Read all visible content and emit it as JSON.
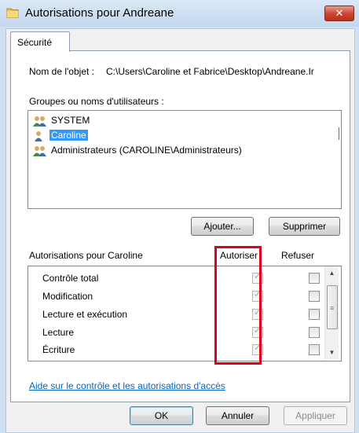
{
  "window": {
    "title": "Autorisations pour Andreane",
    "close_label": "✕"
  },
  "tabs": [
    {
      "label": "Sécurité"
    }
  ],
  "object": {
    "label": "Nom de l'objet :",
    "path": "C:\\Users\\Caroline et Fabrice\\Desktop\\Andreane.Ir"
  },
  "groups": {
    "label": "Groupes ou noms d'utilisateurs :",
    "items": [
      {
        "name": "SYSTEM",
        "icon": "group-users-icon",
        "selected": false
      },
      {
        "name": "Caroline",
        "icon": "user-icon",
        "selected": true
      },
      {
        "name": "Administrateurs (CAROLINE\\Administrateurs)",
        "icon": "group-users-icon",
        "selected": false
      }
    ]
  },
  "buttons": {
    "add": "Ajouter...",
    "remove": "Supprimer",
    "ok": "OK",
    "cancel": "Annuler",
    "apply": "Appliquer"
  },
  "permissions": {
    "label": "Autorisations pour Caroline",
    "allow_header": "Autoriser",
    "deny_header": "Refuser",
    "rows": [
      {
        "name": "Contrôle total",
        "allow": true,
        "deny": false
      },
      {
        "name": "Modification",
        "allow": true,
        "deny": false
      },
      {
        "name": "Lecture et exécution",
        "allow": true,
        "deny": false
      },
      {
        "name": "Lecture",
        "allow": true,
        "deny": false
      },
      {
        "name": "Écriture",
        "allow": true,
        "deny": false
      }
    ]
  },
  "help_link": "Aide sur le contrôle et les autorisations d'accès",
  "colors": {
    "highlight": "#e0001b",
    "selection": "#3399ff",
    "link": "#0066cc"
  }
}
